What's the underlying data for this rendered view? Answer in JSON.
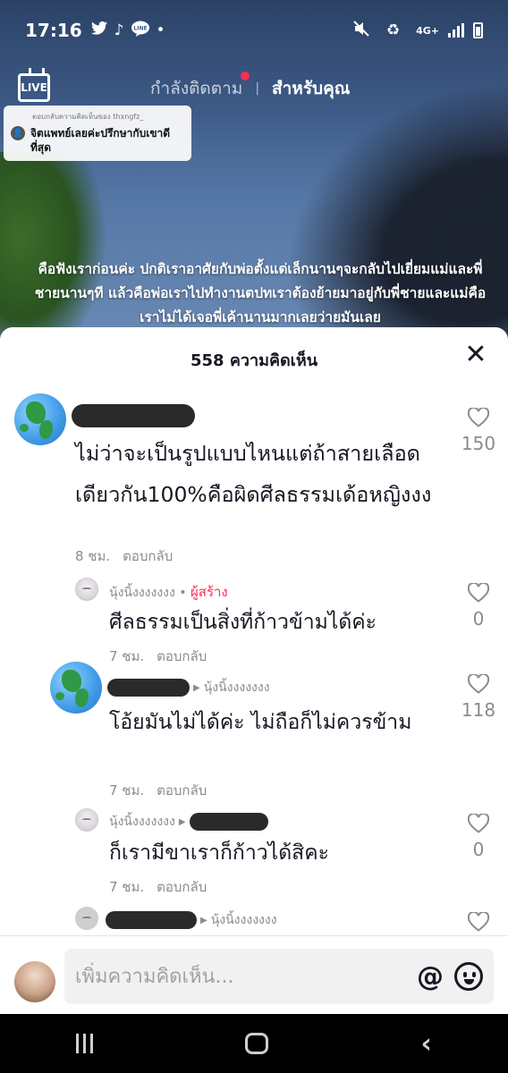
{
  "status_bar": {
    "time": "17:16",
    "network": "4G+",
    "icons": [
      "twitter-icon",
      "tiktok-icon",
      "line-icon",
      "dot-icon",
      "mute-icon",
      "recycle-icon",
      "signal-icon",
      "battery-icon"
    ]
  },
  "top_nav": {
    "live_label": "LIVE",
    "tab_following": "กำลังติดตาม",
    "tab_for_you": "สำหรับคุณ",
    "accent_color": "#fe2c55"
  },
  "reply_card": {
    "header": "ตอบกลับความคิดเห็นของ thxngfz_",
    "text": "จิตแพทย์เลยค่ะปรึกษากับเขาดีที่สุด"
  },
  "caption": "คือฟังเราก่อนค่ะ ปกติเราอาศัยกับพ่อตั้งแต่เล็กนานๆจะกลับไปเยี่ยมแม่และพี่ชายนานๆที แล้วคือพ่อเราไปทำงานตปทเราต้องย้ายมาอยู่กับพี่ชายและแม่คือเราไม่ได้เจอพี่เค้านานมากเลยว่ายมันเลย",
  "comments_sheet": {
    "title": "558 ความคิดเห็น",
    "reply_label": "ตอบกลับ",
    "creator_label": "ผู้สร้าง",
    "comments": [
      {
        "text": "ไม่ว่าจะเป็นรูปแบบไหนแต่ถ้าสายเลือดเดียวกัน100%คือผิดศีลธรรมเด้อหญิงงง",
        "time": "8 ชม.",
        "likes": "150"
      },
      {
        "author": "นุ้งนิ้งงงงงงง",
        "text": "ศีลธรรมเป็นสิ่งที่ก้าวข้ามได้ค่ะ",
        "time": "7 ชม.",
        "likes": "0"
      },
      {
        "reply_to": "นุ้งนิ้งงงงงงง",
        "text": "โอ้ยมันไม่ได้ค่ะ ไม่ถือก็ไม่ควรข้าม",
        "time": "7 ชม.",
        "likes": "118"
      },
      {
        "author": "นุ้งนิ้งงงงงงง",
        "text": "ก็เรามีขาเราก็ก้าวได้สิคะ",
        "time": "7 ชม.",
        "likes": "0"
      },
      {
        "reply_to": "นุ้งนิ้งงงงงงง"
      }
    ]
  },
  "input": {
    "placeholder": "เพิ่มความคิดเห็น..."
  }
}
